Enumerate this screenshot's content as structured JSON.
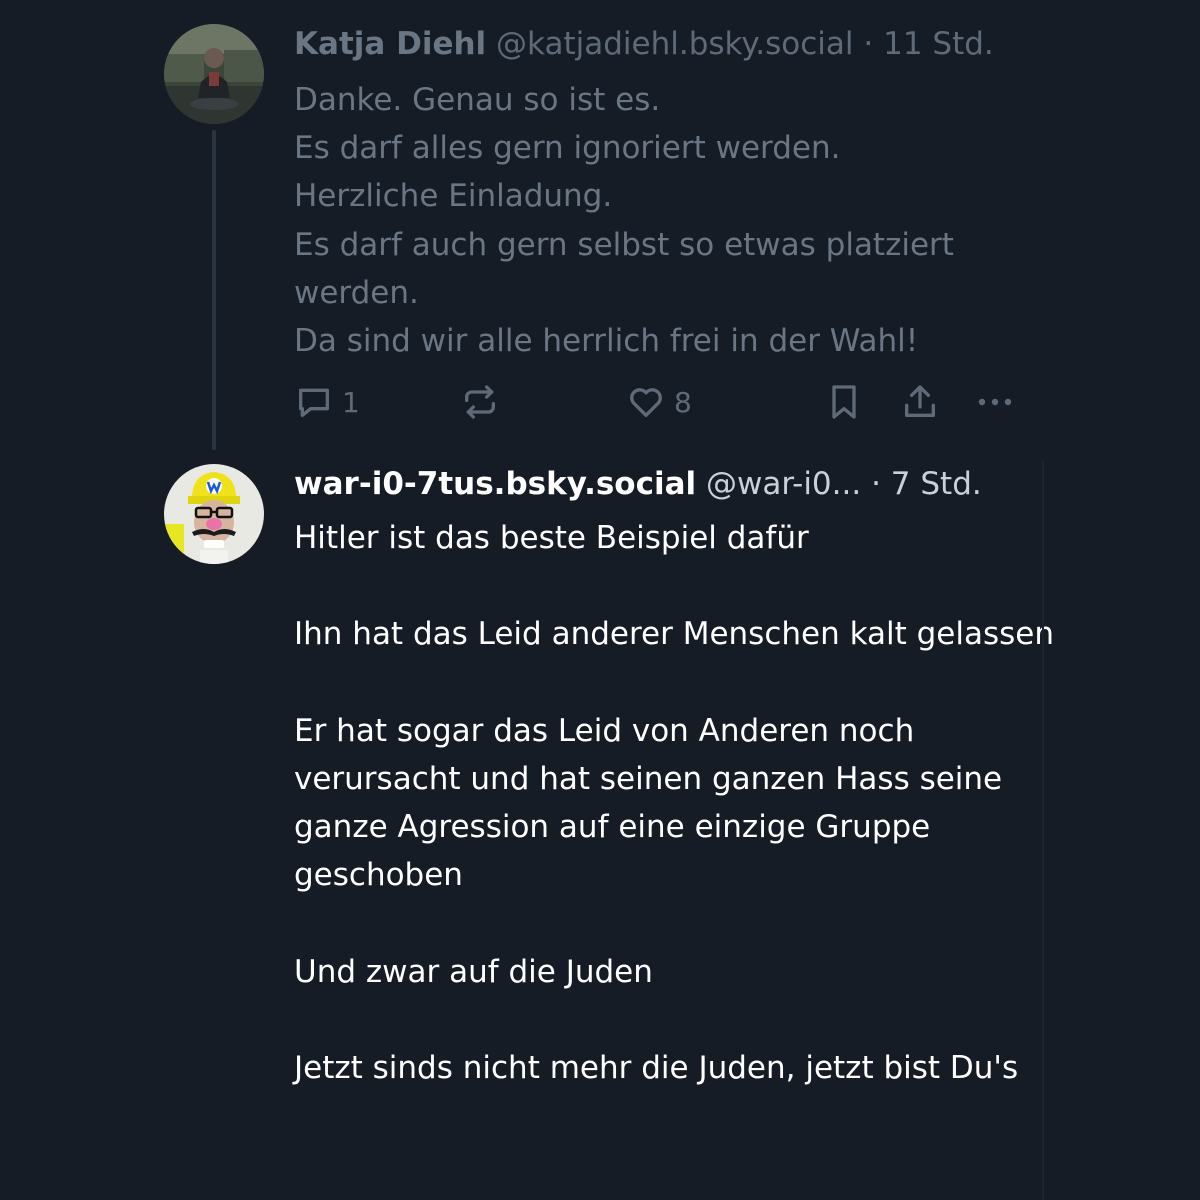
{
  "parent_post": {
    "display_name": "Katja Diehl",
    "handle": "@katjadiehl.bsky.social",
    "separator": "·",
    "time": "11 Std.",
    "text": "Danke. Genau so ist es.\nEs darf alles gern ignoriert werden.\nHerzliche Einladung.\nEs darf auch gern selbst so etwas platziert werden.\nDa sind wir alle herrlich frei in der Wahl!",
    "reply_count": "1",
    "like_count": "8",
    "icons": [
      "reply-icon",
      "repost-icon",
      "like-icon",
      "bookmark-icon",
      "share-icon",
      "more-icon"
    ]
  },
  "reply_post": {
    "display_name": "war-i0-7tus.bsky.social",
    "handle": "@war-i0...",
    "separator": "·",
    "time": "7 Std.",
    "text": "Hitler ist das beste Beispiel dafür\n\nIhn hat das Leid anderer Menschen kalt gelassen\n\nEr hat sogar das Leid von Anderen noch verursacht und hat seinen ganzen Hass seine ganze Agression auf eine einzige Gruppe geschoben\n\nUnd zwar auf die Juden\n\nJetzt sinds nicht mehr die Juden, jetzt bist Du's"
  },
  "colors": {
    "background": "#161c25",
    "faded_text": "#6b7685",
    "primary_text": "#ffffff",
    "thread_line": "#2b3441"
  }
}
